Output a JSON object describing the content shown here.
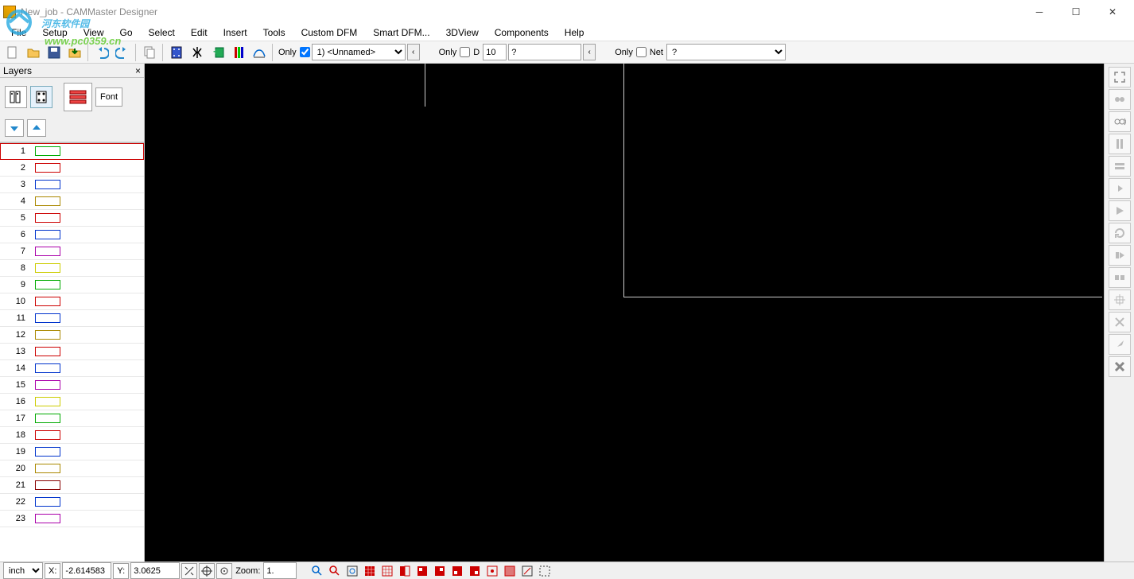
{
  "title": "New_job - CAMMaster Designer",
  "menu": [
    "File",
    "Setup",
    "View",
    "Go",
    "Select",
    "Edit",
    "Insert",
    "Tools",
    "Custom DFM",
    "Smart DFM...",
    "3DView",
    "Components",
    "Help"
  ],
  "toolbar": {
    "only1_label": "Only",
    "only1_checked": true,
    "layer_combo": "1) <Unnamed>",
    "only2_label": "Only",
    "only2_checked": false,
    "d_label": "D",
    "d_value": "10",
    "d_desc": "?",
    "only3_label": "Only",
    "only3_checked": false,
    "net_label": "Net",
    "net_combo": "?"
  },
  "layers_panel": {
    "title": "Layers",
    "font_btn": "Font",
    "rows": [
      {
        "n": "1",
        "color": "#00aa00",
        "sel": true
      },
      {
        "n": "2",
        "color": "#cc0000"
      },
      {
        "n": "3",
        "color": "#0033cc"
      },
      {
        "n": "4",
        "color": "#aa8800"
      },
      {
        "n": "5",
        "color": "#cc0000"
      },
      {
        "n": "6",
        "color": "#0033cc"
      },
      {
        "n": "7",
        "color": "#aa00aa"
      },
      {
        "n": "8",
        "color": "#cccc00"
      },
      {
        "n": "9",
        "color": "#00aa00"
      },
      {
        "n": "10",
        "color": "#cc0000"
      },
      {
        "n": "11",
        "color": "#0033cc"
      },
      {
        "n": "12",
        "color": "#aa8800"
      },
      {
        "n": "13",
        "color": "#cc0000"
      },
      {
        "n": "14",
        "color": "#0033cc"
      },
      {
        "n": "15",
        "color": "#aa00aa"
      },
      {
        "n": "16",
        "color": "#cccc00"
      },
      {
        "n": "17",
        "color": "#00aa00"
      },
      {
        "n": "18",
        "color": "#cc0000"
      },
      {
        "n": "19",
        "color": "#0033cc"
      },
      {
        "n": "20",
        "color": "#aa8800"
      },
      {
        "n": "21",
        "color": "#880000"
      },
      {
        "n": "22",
        "color": "#0033cc"
      },
      {
        "n": "23",
        "color": "#aa00aa"
      }
    ]
  },
  "status": {
    "unit": "inch",
    "x_label": "X:",
    "x_val": "-2.614583",
    "y_label": "Y:",
    "y_val": "3.0625",
    "zoom_label": "Zoom:",
    "zoom_val": "1."
  },
  "watermark": {
    "main": "河东软件园",
    "sub": "www.pc0359.cn"
  }
}
